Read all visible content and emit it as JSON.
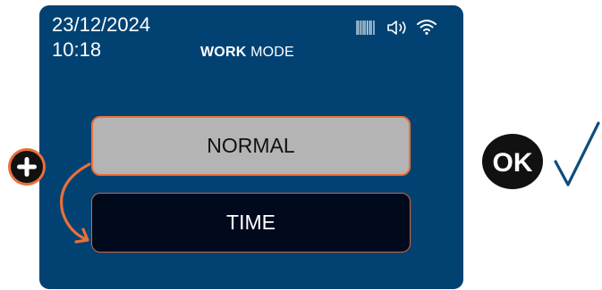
{
  "header": {
    "date": "23/12/2024",
    "time": "10:18",
    "title_bold": "WORK",
    "title_rest": " MODE"
  },
  "status_icons": [
    "barcode-icon",
    "speaker-icon",
    "wifi-icon"
  ],
  "modes": [
    {
      "label": "NORMAL",
      "state": "highlighted"
    },
    {
      "label": "TIME",
      "state": "target"
    }
  ],
  "instructions": {
    "press_icon": "plus-button-icon",
    "direction_icon": "curved-arrow-down-icon",
    "confirm_label": "OK",
    "confirm_icon": "checkmark-icon"
  },
  "colors": {
    "screen_bg": "#014273",
    "accent": "#e8703a",
    "normal_bg": "#b4b4b4",
    "time_bg": "#000a1c",
    "check": "#0e4d7c"
  }
}
